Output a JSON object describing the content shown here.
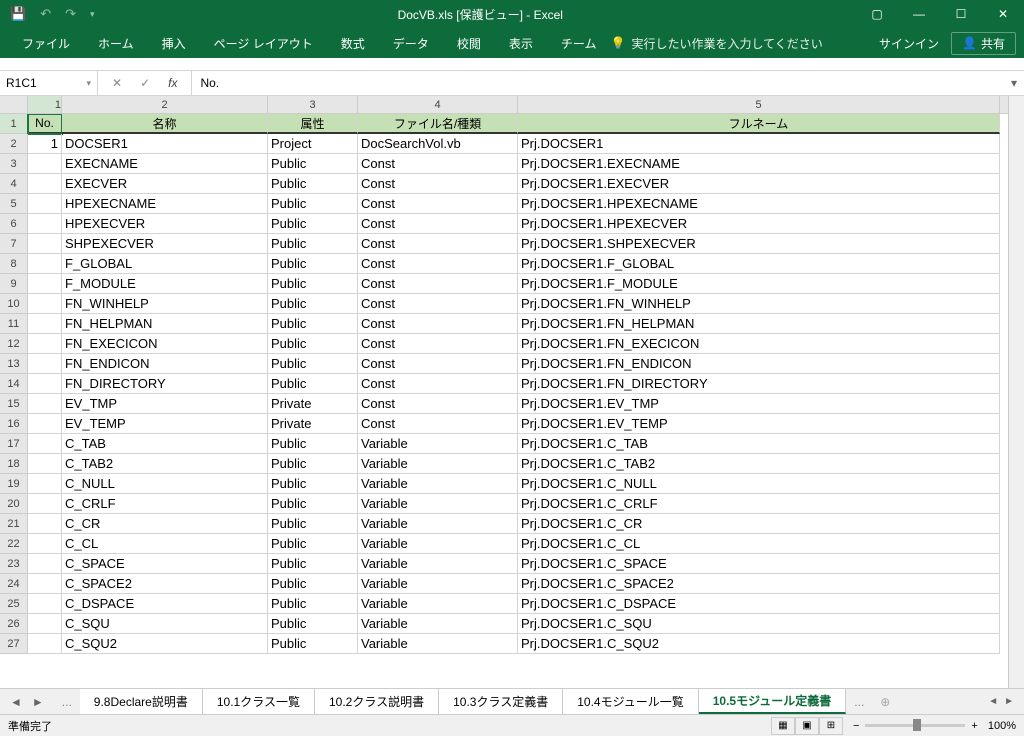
{
  "titlebar": {
    "title": "DocVB.xls  [保護ビュー] - Excel"
  },
  "ribbon": {
    "tabs": [
      "ファイル",
      "ホーム",
      "挿入",
      "ページ レイアウト",
      "数式",
      "データ",
      "校閲",
      "表示",
      "チーム"
    ],
    "tellme": "実行したい作業を入力してください",
    "signin": "サインイン",
    "share": "共有"
  },
  "formula": {
    "namebox": "R1C1",
    "value": "No."
  },
  "columns": [
    {
      "num": "1",
      "header": "No.",
      "w": "c1"
    },
    {
      "num": "2",
      "header": "名称",
      "w": "c2"
    },
    {
      "num": "3",
      "header": "属性",
      "w": "c3"
    },
    {
      "num": "4",
      "header": "ファイル名/種類",
      "w": "c4"
    },
    {
      "num": "5",
      "header": "フルネーム",
      "w": "c5"
    }
  ],
  "rows": [
    {
      "n": "1",
      "no": "1",
      "name": "DOCSER1",
      "attr": "Project",
      "file": "DocSearchVol.vb",
      "full": "Prj.DOCSER1"
    },
    {
      "n": "2",
      "no": "",
      "name": "EXECNAME",
      "attr": "Public",
      "file": "Const",
      "full": "Prj.DOCSER1.EXECNAME"
    },
    {
      "n": "3",
      "no": "",
      "name": "EXECVER",
      "attr": "Public",
      "file": "Const",
      "full": "Prj.DOCSER1.EXECVER"
    },
    {
      "n": "4",
      "no": "",
      "name": "HPEXECNAME",
      "attr": "Public",
      "file": "Const",
      "full": "Prj.DOCSER1.HPEXECNAME"
    },
    {
      "n": "5",
      "no": "",
      "name": "HPEXECVER",
      "attr": "Public",
      "file": "Const",
      "full": "Prj.DOCSER1.HPEXECVER"
    },
    {
      "n": "6",
      "no": "",
      "name": "SHPEXECVER",
      "attr": "Public",
      "file": "Const",
      "full": "Prj.DOCSER1.SHPEXECVER"
    },
    {
      "n": "7",
      "no": "",
      "name": "F_GLOBAL",
      "attr": "Public",
      "file": "Const",
      "full": "Prj.DOCSER1.F_GLOBAL"
    },
    {
      "n": "8",
      "no": "",
      "name": "F_MODULE",
      "attr": "Public",
      "file": "Const",
      "full": "Prj.DOCSER1.F_MODULE"
    },
    {
      "n": "9",
      "no": "",
      "name": "FN_WINHELP",
      "attr": "Public",
      "file": "Const",
      "full": "Prj.DOCSER1.FN_WINHELP"
    },
    {
      "n": "10",
      "no": "",
      "name": "FN_HELPMAN",
      "attr": "Public",
      "file": "Const",
      "full": "Prj.DOCSER1.FN_HELPMAN"
    },
    {
      "n": "11",
      "no": "",
      "name": "FN_EXECICON",
      "attr": "Public",
      "file": "Const",
      "full": "Prj.DOCSER1.FN_EXECICON"
    },
    {
      "n": "12",
      "no": "",
      "name": "FN_ENDICON",
      "attr": "Public",
      "file": "Const",
      "full": "Prj.DOCSER1.FN_ENDICON"
    },
    {
      "n": "13",
      "no": "",
      "name": "FN_DIRECTORY",
      "attr": "Public",
      "file": "Const",
      "full": "Prj.DOCSER1.FN_DIRECTORY"
    },
    {
      "n": "14",
      "no": "",
      "name": "EV_TMP",
      "attr": "Private",
      "file": "Const",
      "full": "Prj.DOCSER1.EV_TMP"
    },
    {
      "n": "15",
      "no": "",
      "name": "EV_TEMP",
      "attr": "Private",
      "file": "Const",
      "full": "Prj.DOCSER1.EV_TEMP"
    },
    {
      "n": "16",
      "no": "",
      "name": "C_TAB",
      "attr": "Public",
      "file": "Variable",
      "full": "Prj.DOCSER1.C_TAB"
    },
    {
      "n": "17",
      "no": "",
      "name": "C_TAB2",
      "attr": "Public",
      "file": "Variable",
      "full": "Prj.DOCSER1.C_TAB2"
    },
    {
      "n": "18",
      "no": "",
      "name": "C_NULL",
      "attr": "Public",
      "file": "Variable",
      "full": "Prj.DOCSER1.C_NULL"
    },
    {
      "n": "19",
      "no": "",
      "name": "C_CRLF",
      "attr": "Public",
      "file": "Variable",
      "full": "Prj.DOCSER1.C_CRLF"
    },
    {
      "n": "20",
      "no": "",
      "name": "C_CR",
      "attr": "Public",
      "file": "Variable",
      "full": "Prj.DOCSER1.C_CR"
    },
    {
      "n": "21",
      "no": "",
      "name": "C_CL",
      "attr": "Public",
      "file": "Variable",
      "full": "Prj.DOCSER1.C_CL"
    },
    {
      "n": "22",
      "no": "",
      "name": "C_SPACE",
      "attr": "Public",
      "file": "Variable",
      "full": "Prj.DOCSER1.C_SPACE"
    },
    {
      "n": "23",
      "no": "",
      "name": "C_SPACE2",
      "attr": "Public",
      "file": "Variable",
      "full": "Prj.DOCSER1.C_SPACE2"
    },
    {
      "n": "24",
      "no": "",
      "name": "C_DSPACE",
      "attr": "Public",
      "file": "Variable",
      "full": "Prj.DOCSER1.C_DSPACE"
    },
    {
      "n": "25",
      "no": "",
      "name": "C_SQU",
      "attr": "Public",
      "file": "Variable",
      "full": "Prj.DOCSER1.C_SQU"
    },
    {
      "n": "26",
      "no": "",
      "name": "C_SQU2",
      "attr": "Public",
      "file": "Variable",
      "full": "Prj.DOCSER1.C_SQU2"
    }
  ],
  "sheets": {
    "ellipsis": "...",
    "tabs": [
      "9.8Declare説明書",
      "10.1クラス一覧",
      "10.2クラス説明書",
      "10.3クラス定義書",
      "10.4モジュール一覧",
      "10.5モジュール定義書"
    ],
    "active": 5
  },
  "status": {
    "ready": "準備完了",
    "zoom": "100%"
  }
}
